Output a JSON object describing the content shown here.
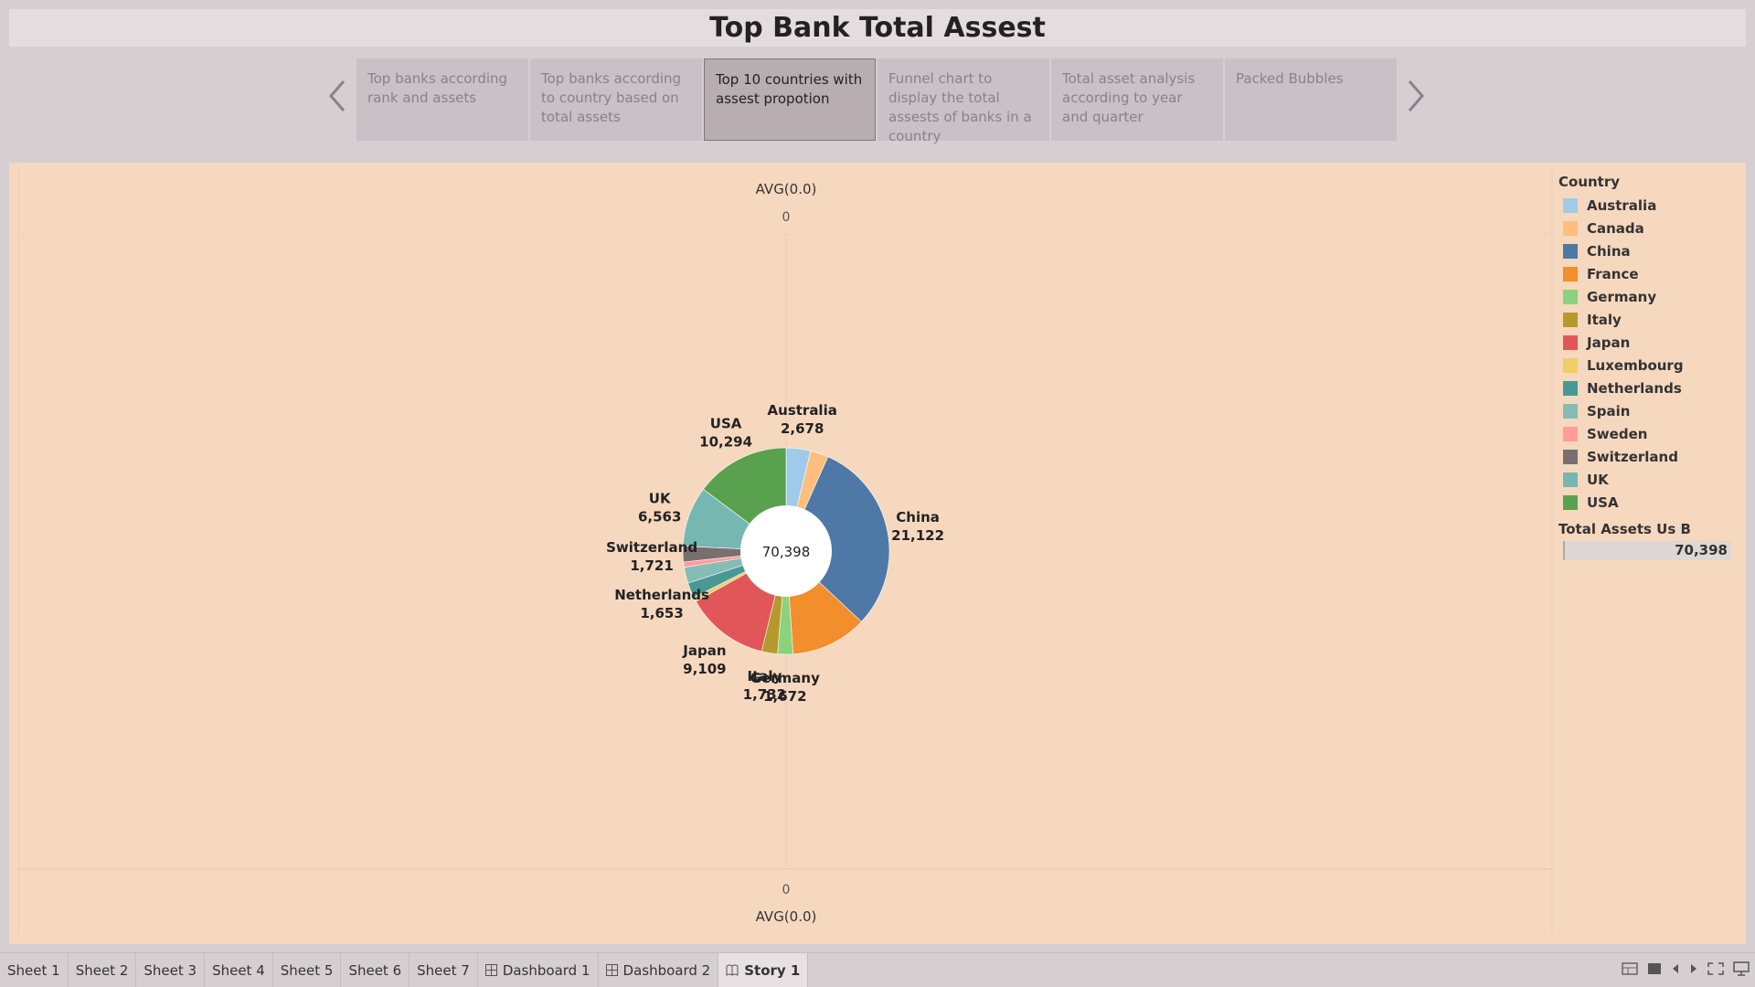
{
  "title": "Top Bank Total Assest",
  "story_points": [
    {
      "label": "Top banks according rank and assets",
      "active": false
    },
    {
      "label": "Top banks according to country based on total assets",
      "active": false
    },
    {
      "label": "Top 10 countries with assest propotion",
      "active": true
    },
    {
      "label": "Funnel chart to display the total assests of banks in a country",
      "active": false
    },
    {
      "label": "Total asset analysis according to year and quarter",
      "active": false
    },
    {
      "label": "Packed Bubbles",
      "active": false
    }
  ],
  "axis": {
    "top_label": "AVG(0.0)",
    "top_tick": "0",
    "bottom_tick": "0",
    "bottom_label": "AVG(0.0)"
  },
  "center_total": "70,398",
  "chart_data": {
    "type": "pie",
    "donut": true,
    "slices": [
      {
        "name": "Australia",
        "value": 2678,
        "color": "#a0cbe8",
        "label": "2,678",
        "show": true
      },
      {
        "name": "Canada",
        "value": 1950,
        "color": "#ffbe7d",
        "label": "",
        "show": false
      },
      {
        "name": "China",
        "value": 21122,
        "color": "#4e79a7",
        "label": "21,122",
        "show": true
      },
      {
        "name": "France",
        "value": 8300,
        "color": "#f28e2b",
        "label": "",
        "show": false
      },
      {
        "name": "Germany",
        "value": 1672,
        "color": "#8cd17d",
        "label": "1,672",
        "show": true
      },
      {
        "name": "Italy",
        "value": 1732,
        "color": "#b6992d",
        "label": "1,732",
        "show": true
      },
      {
        "name": "Japan",
        "value": 9109,
        "color": "#e15759",
        "label": "9,109",
        "show": true
      },
      {
        "name": "Luxembourg",
        "value": 480,
        "color": "#f1ce63",
        "label": "",
        "show": false
      },
      {
        "name": "Netherlands",
        "value": 1653,
        "color": "#499894",
        "label": "1,653",
        "show": true
      },
      {
        "name": "Spain",
        "value": 1750,
        "color": "#86bcb6",
        "label": "",
        "show": false
      },
      {
        "name": "Sweden",
        "value": 574,
        "color": "#ff9d9a",
        "label": "",
        "show": false
      },
      {
        "name": "Switzerland",
        "value": 1721,
        "color": "#79706e",
        "label": "1,721",
        "show": true
      },
      {
        "name": "UK",
        "value": 6563,
        "color": "#76b7b2",
        "label": "6,563",
        "show": true
      },
      {
        "name": "USA",
        "value": 10294,
        "color": "#59a14f",
        "label": "10,294",
        "show": true
      }
    ]
  },
  "legend": {
    "title": "Country",
    "items": [
      {
        "label": "Australia",
        "color": "#a0cbe8"
      },
      {
        "label": "Canada",
        "color": "#ffbe7d"
      },
      {
        "label": "China",
        "color": "#4e79a7"
      },
      {
        "label": "France",
        "color": "#f28e2b"
      },
      {
        "label": "Germany",
        "color": "#8cd17d"
      },
      {
        "label": "Italy",
        "color": "#b6992d"
      },
      {
        "label": "Japan",
        "color": "#e15759"
      },
      {
        "label": "Luxembourg",
        "color": "#f1ce63"
      },
      {
        "label": "Netherlands",
        "color": "#499894"
      },
      {
        "label": "Spain",
        "color": "#86bcb6"
      },
      {
        "label": "Sweden",
        "color": "#ff9d9a"
      },
      {
        "label": "Switzerland",
        "color": "#79706e"
      },
      {
        "label": "UK",
        "color": "#76b7b2"
      },
      {
        "label": "USA",
        "color": "#59a14f"
      }
    ],
    "size_title": "Total Assets Us B",
    "size_value": "70,398"
  },
  "tabs": [
    {
      "label": "Sheet 1",
      "icon": "",
      "active": false
    },
    {
      "label": "Sheet 2",
      "icon": "",
      "active": false
    },
    {
      "label": "Sheet 3",
      "icon": "",
      "active": false
    },
    {
      "label": "Sheet 4",
      "icon": "",
      "active": false
    },
    {
      "label": "Sheet 5",
      "icon": "",
      "active": false
    },
    {
      "label": "Sheet 6",
      "icon": "",
      "active": false
    },
    {
      "label": "Sheet 7",
      "icon": "",
      "active": false
    },
    {
      "label": "Dashboard 1",
      "icon": "dashboard-icon",
      "active": false
    },
    {
      "label": "Dashboard 2",
      "icon": "dashboard-icon",
      "active": false
    },
    {
      "label": "Story 1",
      "icon": "story-icon",
      "active": true
    }
  ],
  "status_icons": [
    "show-sheets-icon",
    "filmstrip-icon",
    "previous-icon",
    "next-icon",
    "fullscreen-icon",
    "presentation-icon"
  ]
}
